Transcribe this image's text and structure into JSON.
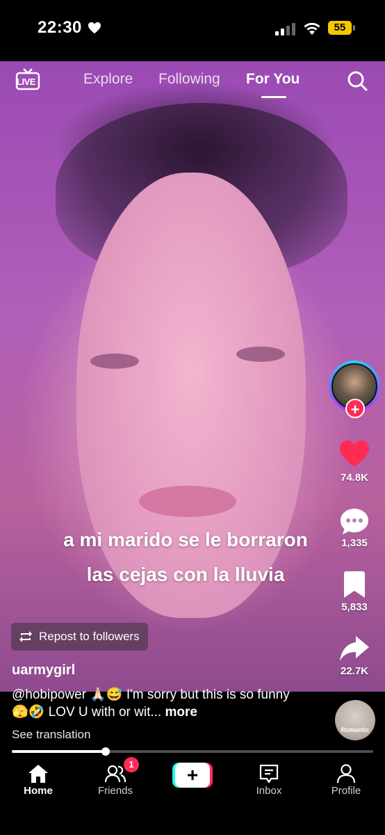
{
  "status_bar": {
    "time": "22:30",
    "battery": "55"
  },
  "top_nav": {
    "live_label": "LIVE",
    "tabs": [
      {
        "label": "Explore"
      },
      {
        "label": "Following"
      },
      {
        "label": "For You",
        "active": true
      }
    ]
  },
  "video": {
    "caption_line1": "a mi marido se le borraron",
    "caption_line2": "las cejas con la lluvia",
    "progress": 0.26
  },
  "actions": {
    "likes": "74.8K",
    "comments": "1,335",
    "saves": "5,833",
    "shares": "22.7K"
  },
  "repost": {
    "label": "Repost to followers"
  },
  "post": {
    "username": "uarmygirl",
    "description": "@hobipower 🙏🏻😅 I'm sorry but this is so funny 🫣🤣 LOV U with or wit...",
    "more_label": "more",
    "see_translation": "See translation",
    "music_label": "Romantic"
  },
  "tab_bar": {
    "home": "Home",
    "friends": "Friends",
    "friends_badge": "1",
    "inbox": "Inbox",
    "profile": "Profile"
  },
  "colors": {
    "accent": "#fe2c55",
    "cyan": "#25f4ee",
    "battery": "#f5c800"
  }
}
